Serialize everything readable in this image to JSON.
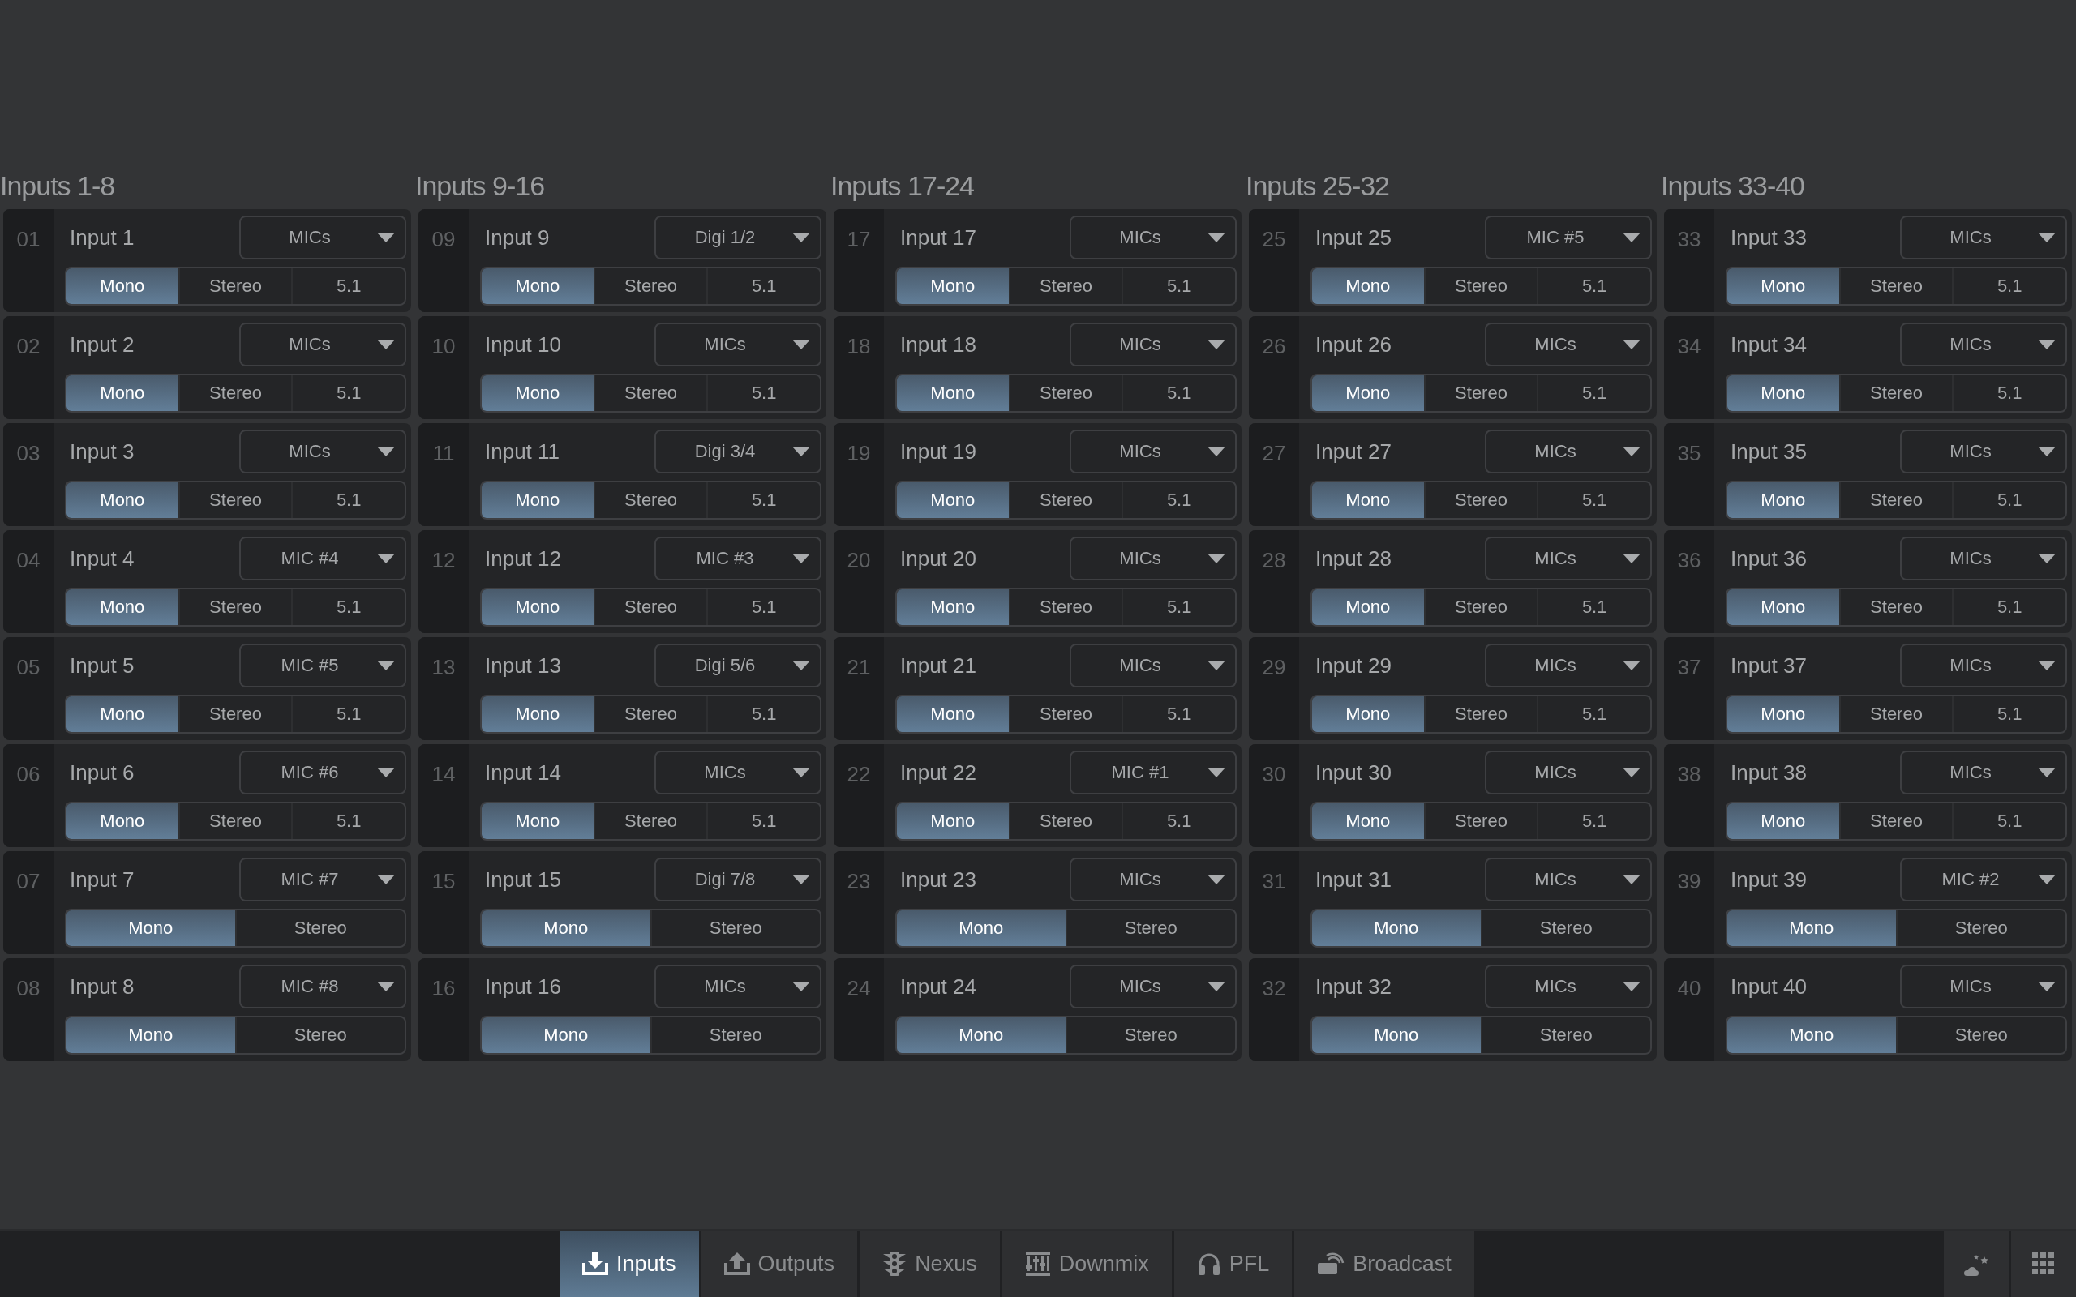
{
  "groups": [
    {
      "title": "Inputs 1-8",
      "inputs": [
        {
          "number": "01",
          "name": "Input 1",
          "source": "MICs",
          "modes": [
            {
              "label": "Mono",
              "selected": true
            },
            {
              "label": "Stereo",
              "selected": false
            },
            {
              "label": "5.1",
              "selected": false
            }
          ]
        },
        {
          "number": "02",
          "name": "Input 2",
          "source": "MICs",
          "modes": [
            {
              "label": "Mono",
              "selected": true
            },
            {
              "label": "Stereo",
              "selected": false
            },
            {
              "label": "5.1",
              "selected": false
            }
          ]
        },
        {
          "number": "03",
          "name": "Input 3",
          "source": "MICs",
          "modes": [
            {
              "label": "Mono",
              "selected": true
            },
            {
              "label": "Stereo",
              "selected": false
            },
            {
              "label": "5.1",
              "selected": false
            }
          ]
        },
        {
          "number": "04",
          "name": "Input 4",
          "source": "MIC #4",
          "modes": [
            {
              "label": "Mono",
              "selected": true
            },
            {
              "label": "Stereo",
              "selected": false
            },
            {
              "label": "5.1",
              "selected": false
            }
          ]
        },
        {
          "number": "05",
          "name": "Input 5",
          "source": "MIC #5",
          "modes": [
            {
              "label": "Mono",
              "selected": true
            },
            {
              "label": "Stereo",
              "selected": false
            },
            {
              "label": "5.1",
              "selected": false
            }
          ]
        },
        {
          "number": "06",
          "name": "Input 6",
          "source": "MIC #6",
          "modes": [
            {
              "label": "Mono",
              "selected": true
            },
            {
              "label": "Stereo",
              "selected": false
            },
            {
              "label": "5.1",
              "selected": false
            }
          ]
        },
        {
          "number": "07",
          "name": "Input 7",
          "source": "MIC #7",
          "modes": [
            {
              "label": "Mono",
              "selected": true
            },
            {
              "label": "Stereo",
              "selected": false
            }
          ]
        },
        {
          "number": "08",
          "name": "Input 8",
          "source": "MIC #8",
          "modes": [
            {
              "label": "Mono",
              "selected": true
            },
            {
              "label": "Stereo",
              "selected": false
            }
          ]
        }
      ]
    },
    {
      "title": "Inputs 9-16",
      "inputs": [
        {
          "number": "09",
          "name": "Input 9",
          "source": "Digi 1/2",
          "modes": [
            {
              "label": "Mono",
              "selected": true
            },
            {
              "label": "Stereo",
              "selected": false
            },
            {
              "label": "5.1",
              "selected": false
            }
          ]
        },
        {
          "number": "10",
          "name": "Input 10",
          "source": "MICs",
          "modes": [
            {
              "label": "Mono",
              "selected": true
            },
            {
              "label": "Stereo",
              "selected": false
            },
            {
              "label": "5.1",
              "selected": false
            }
          ]
        },
        {
          "number": "11",
          "name": "Input 11",
          "source": "Digi 3/4",
          "modes": [
            {
              "label": "Mono",
              "selected": true
            },
            {
              "label": "Stereo",
              "selected": false
            },
            {
              "label": "5.1",
              "selected": false
            }
          ]
        },
        {
          "number": "12",
          "name": "Input 12",
          "source": "MIC #3",
          "modes": [
            {
              "label": "Mono",
              "selected": true
            },
            {
              "label": "Stereo",
              "selected": false
            },
            {
              "label": "5.1",
              "selected": false
            }
          ]
        },
        {
          "number": "13",
          "name": "Input 13",
          "source": "Digi 5/6",
          "modes": [
            {
              "label": "Mono",
              "selected": true
            },
            {
              "label": "Stereo",
              "selected": false
            },
            {
              "label": "5.1",
              "selected": false
            }
          ]
        },
        {
          "number": "14",
          "name": "Input 14",
          "source": "MICs",
          "modes": [
            {
              "label": "Mono",
              "selected": true
            },
            {
              "label": "Stereo",
              "selected": false
            },
            {
              "label": "5.1",
              "selected": false
            }
          ]
        },
        {
          "number": "15",
          "name": "Input 15",
          "source": "Digi 7/8",
          "modes": [
            {
              "label": "Mono",
              "selected": true
            },
            {
              "label": "Stereo",
              "selected": false
            }
          ]
        },
        {
          "number": "16",
          "name": "Input 16",
          "source": "MICs",
          "modes": [
            {
              "label": "Mono",
              "selected": true
            },
            {
              "label": "Stereo",
              "selected": false
            }
          ]
        }
      ]
    },
    {
      "title": "Inputs 17-24",
      "inputs": [
        {
          "number": "17",
          "name": "Input 17",
          "source": "MICs",
          "modes": [
            {
              "label": "Mono",
              "selected": true
            },
            {
              "label": "Stereo",
              "selected": false
            },
            {
              "label": "5.1",
              "selected": false
            }
          ]
        },
        {
          "number": "18",
          "name": "Input 18",
          "source": "MICs",
          "modes": [
            {
              "label": "Mono",
              "selected": true
            },
            {
              "label": "Stereo",
              "selected": false
            },
            {
              "label": "5.1",
              "selected": false
            }
          ]
        },
        {
          "number": "19",
          "name": "Input 19",
          "source": "MICs",
          "modes": [
            {
              "label": "Mono",
              "selected": true
            },
            {
              "label": "Stereo",
              "selected": false
            },
            {
              "label": "5.1",
              "selected": false
            }
          ]
        },
        {
          "number": "20",
          "name": "Input 20",
          "source": "MICs",
          "modes": [
            {
              "label": "Mono",
              "selected": true
            },
            {
              "label": "Stereo",
              "selected": false
            },
            {
              "label": "5.1",
              "selected": false
            }
          ]
        },
        {
          "number": "21",
          "name": "Input 21",
          "source": "MICs",
          "modes": [
            {
              "label": "Mono",
              "selected": true
            },
            {
              "label": "Stereo",
              "selected": false
            },
            {
              "label": "5.1",
              "selected": false
            }
          ]
        },
        {
          "number": "22",
          "name": "Input 22",
          "source": "MIC #1",
          "modes": [
            {
              "label": "Mono",
              "selected": true
            },
            {
              "label": "Stereo",
              "selected": false
            },
            {
              "label": "5.1",
              "selected": false
            }
          ]
        },
        {
          "number": "23",
          "name": "Input 23",
          "source": "MICs",
          "modes": [
            {
              "label": "Mono",
              "selected": true
            },
            {
              "label": "Stereo",
              "selected": false
            }
          ]
        },
        {
          "number": "24",
          "name": "Input 24",
          "source": "MICs",
          "modes": [
            {
              "label": "Mono",
              "selected": true
            },
            {
              "label": "Stereo",
              "selected": false
            }
          ]
        }
      ]
    },
    {
      "title": "Inputs 25-32",
      "inputs": [
        {
          "number": "25",
          "name": "Input 25",
          "source": "MIC #5",
          "modes": [
            {
              "label": "Mono",
              "selected": true
            },
            {
              "label": "Stereo",
              "selected": false
            },
            {
              "label": "5.1",
              "selected": false
            }
          ]
        },
        {
          "number": "26",
          "name": "Input 26",
          "source": "MICs",
          "modes": [
            {
              "label": "Mono",
              "selected": true
            },
            {
              "label": "Stereo",
              "selected": false
            },
            {
              "label": "5.1",
              "selected": false
            }
          ]
        },
        {
          "number": "27",
          "name": "Input 27",
          "source": "MICs",
          "modes": [
            {
              "label": "Mono",
              "selected": true
            },
            {
              "label": "Stereo",
              "selected": false
            },
            {
              "label": "5.1",
              "selected": false
            }
          ]
        },
        {
          "number": "28",
          "name": "Input 28",
          "source": "MICs",
          "modes": [
            {
              "label": "Mono",
              "selected": true
            },
            {
              "label": "Stereo",
              "selected": false
            },
            {
              "label": "5.1",
              "selected": false
            }
          ]
        },
        {
          "number": "29",
          "name": "Input 29",
          "source": "MICs",
          "modes": [
            {
              "label": "Mono",
              "selected": true
            },
            {
              "label": "Stereo",
              "selected": false
            },
            {
              "label": "5.1",
              "selected": false
            }
          ]
        },
        {
          "number": "30",
          "name": "Input 30",
          "source": "MICs",
          "modes": [
            {
              "label": "Mono",
              "selected": true
            },
            {
              "label": "Stereo",
              "selected": false
            },
            {
              "label": "5.1",
              "selected": false
            }
          ]
        },
        {
          "number": "31",
          "name": "Input 31",
          "source": "MICs",
          "modes": [
            {
              "label": "Mono",
              "selected": true
            },
            {
              "label": "Stereo",
              "selected": false
            }
          ]
        },
        {
          "number": "32",
          "name": "Input 32",
          "source": "MICs",
          "modes": [
            {
              "label": "Mono",
              "selected": true
            },
            {
              "label": "Stereo",
              "selected": false
            }
          ]
        }
      ]
    },
    {
      "title": "Inputs 33-40",
      "inputs": [
        {
          "number": "33",
          "name": "Input 33",
          "source": "MICs",
          "modes": [
            {
              "label": "Mono",
              "selected": true
            },
            {
              "label": "Stereo",
              "selected": false
            },
            {
              "label": "5.1",
              "selected": false
            }
          ]
        },
        {
          "number": "34",
          "name": "Input 34",
          "source": "MICs",
          "modes": [
            {
              "label": "Mono",
              "selected": true
            },
            {
              "label": "Stereo",
              "selected": false
            },
            {
              "label": "5.1",
              "selected": false
            }
          ]
        },
        {
          "number": "35",
          "name": "Input 35",
          "source": "MICs",
          "modes": [
            {
              "label": "Mono",
              "selected": true
            },
            {
              "label": "Stereo",
              "selected": false
            },
            {
              "label": "5.1",
              "selected": false
            }
          ]
        },
        {
          "number": "36",
          "name": "Input 36",
          "source": "MICs",
          "modes": [
            {
              "label": "Mono",
              "selected": true
            },
            {
              "label": "Stereo",
              "selected": false
            },
            {
              "label": "5.1",
              "selected": false
            }
          ]
        },
        {
          "number": "37",
          "name": "Input 37",
          "source": "MICs",
          "modes": [
            {
              "label": "Mono",
              "selected": true
            },
            {
              "label": "Stereo",
              "selected": false
            },
            {
              "label": "5.1",
              "selected": false
            }
          ]
        },
        {
          "number": "38",
          "name": "Input 38",
          "source": "MICs",
          "modes": [
            {
              "label": "Mono",
              "selected": true
            },
            {
              "label": "Stereo",
              "selected": false
            },
            {
              "label": "5.1",
              "selected": false
            }
          ]
        },
        {
          "number": "39",
          "name": "Input 39",
          "source": "MIC #2",
          "modes": [
            {
              "label": "Mono",
              "selected": true
            },
            {
              "label": "Stereo",
              "selected": false
            }
          ]
        },
        {
          "number": "40",
          "name": "Input 40",
          "source": "MICs",
          "modes": [
            {
              "label": "Mono",
              "selected": true
            },
            {
              "label": "Stereo",
              "selected": false
            }
          ]
        }
      ]
    }
  ],
  "tabs": [
    {
      "label": "Inputs",
      "kind": "inputs",
      "selected": true
    },
    {
      "label": "Outputs",
      "kind": "outputs",
      "selected": false
    },
    {
      "label": "Nexus",
      "kind": "nexus",
      "selected": false
    },
    {
      "label": "Downmix",
      "kind": "downmix",
      "selected": false
    },
    {
      "label": "PFL",
      "kind": "pfl",
      "selected": false
    },
    {
      "label": "Broadcast",
      "kind": "broadcast",
      "selected": false
    }
  ]
}
